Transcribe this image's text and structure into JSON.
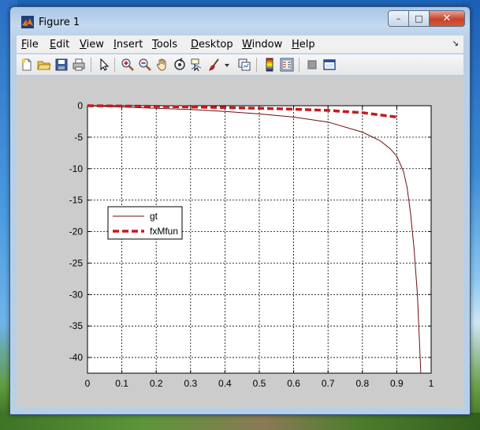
{
  "window": {
    "title": "Figure 1"
  },
  "window_controls": {
    "minimize": "–",
    "maximize": "□",
    "close": "✕"
  },
  "menu": {
    "items": [
      {
        "mn": "F",
        "rest": "ile"
      },
      {
        "mn": "E",
        "rest": "dit"
      },
      {
        "mn": "V",
        "rest": "iew"
      },
      {
        "mn": "I",
        "rest": "nsert"
      },
      {
        "mn": "T",
        "rest": "ools"
      },
      {
        "mn": "D",
        "rest": "esktop"
      },
      {
        "mn": "W",
        "rest": "indow"
      },
      {
        "mn": "H",
        "rest": "elp"
      }
    ],
    "overflow_arrow": "↘"
  },
  "toolbar": {
    "tools": [
      "new-figure-icon",
      "open-file-icon",
      "save-icon",
      "print-icon",
      "pointer-icon",
      "zoom-in-icon",
      "zoom-out-icon",
      "pan-hand-icon",
      "rotate-3d-icon",
      "data-cursor-icon",
      "brush-icon",
      "brush-dropdown-icon",
      "link-plot-icon",
      "colorbar-icon",
      "legend-icon",
      "hide-plot-tools-icon",
      "show-plot-tools-icon"
    ]
  },
  "colors": {
    "gt": "#6b0e14",
    "fxMfun": "#c8191c",
    "figure_bg": "#cccccc",
    "axes_bg": "#ffffff"
  },
  "chart_data": {
    "type": "line",
    "xlim": [
      0,
      1
    ],
    "ylim": [
      -42.5,
      0
    ],
    "xticks": [
      0,
      0.1,
      0.2,
      0.3,
      0.4,
      0.5,
      0.6,
      0.7,
      0.8,
      0.9,
      1
    ],
    "yticks": [
      0,
      -5,
      -10,
      -15,
      -20,
      -25,
      -30,
      -35,
      -40
    ],
    "xtick_labels": [
      "0",
      "0.1",
      "0.2",
      "0.3",
      "0.4",
      "0.5",
      "0.6",
      "0.7",
      "0.8",
      "0.9",
      "1"
    ],
    "ytick_labels": [
      "0",
      "-5",
      "-10",
      "-15",
      "-20",
      "-25",
      "-30",
      "-35",
      "-40"
    ],
    "grid": true,
    "legend_position": "middle-left",
    "series": [
      {
        "name": "gt",
        "style": "solid",
        "x": [
          0,
          0.1,
          0.2,
          0.3,
          0.4,
          0.5,
          0.6,
          0.7,
          0.8,
          0.85,
          0.88,
          0.9,
          0.92,
          0.93,
          0.94,
          0.95,
          0.96,
          0.97
        ],
        "y": [
          0,
          -0.2,
          -0.4,
          -0.6,
          -0.9,
          -1.3,
          -1.8,
          -2.6,
          -4.2,
          -5.5,
          -6.8,
          -8.0,
          -10.5,
          -13.0,
          -17.0,
          -22.5,
          -30.0,
          -42.5
        ]
      },
      {
        "name": "fxMfun",
        "style": "dashed",
        "x": [
          0,
          0.1,
          0.2,
          0.3,
          0.4,
          0.5,
          0.6,
          0.7,
          0.8,
          0.9
        ],
        "y": [
          0,
          -0.05,
          -0.1,
          -0.2,
          -0.3,
          -0.4,
          -0.55,
          -0.75,
          -1.1,
          -1.8
        ]
      }
    ]
  }
}
